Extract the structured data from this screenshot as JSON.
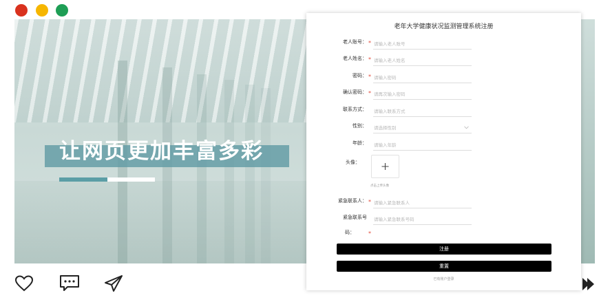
{
  "window_controls": {
    "close_color": "#d9321e",
    "minimize_color": "#f6b600",
    "maximize_color": "#1e9e55"
  },
  "banner": {
    "headline": "让网页更加丰富多彩",
    "accent_color": "#5b9ea6"
  },
  "form": {
    "title": "老年大学健康状况监测管理系统注册",
    "fields": [
      {
        "label": "老人账号：",
        "required": true,
        "placeholder": "请输入老人账号"
      },
      {
        "label": "老人姓名：",
        "required": true,
        "placeholder": "请输入老人姓名"
      },
      {
        "label": "密码：",
        "required": true,
        "placeholder": "请输入密码"
      },
      {
        "label": "确认密码：",
        "required": true,
        "placeholder": "请再次输入密码"
      },
      {
        "label": "联系方式：",
        "required": false,
        "placeholder": "请输入联系方式"
      },
      {
        "label": "性别：",
        "required": false,
        "placeholder": "请选择性别",
        "icon": "chevron-down-icon"
      },
      {
        "label": "年龄：",
        "required": false,
        "placeholder": "请输入年龄"
      }
    ],
    "avatar": {
      "label": "头像：",
      "hint": "点击上传头像",
      "icon": "plus-icon"
    },
    "emergency_contact": {
      "label": "紧急联系人：",
      "required": true,
      "placeholder": "请输入紧急联系人"
    },
    "emergency_phone": {
      "label_line1": "紧急联系号",
      "label_line2": "码：",
      "required": true,
      "placeholder": "请输入紧急联系号码"
    },
    "required_mark": "*",
    "register_button": "注册",
    "reset_button": "重置",
    "login_link": "已有账户登录"
  },
  "footer_icons": [
    "heart-icon",
    "comment-icon",
    "send-icon",
    "bookmark-icon"
  ]
}
